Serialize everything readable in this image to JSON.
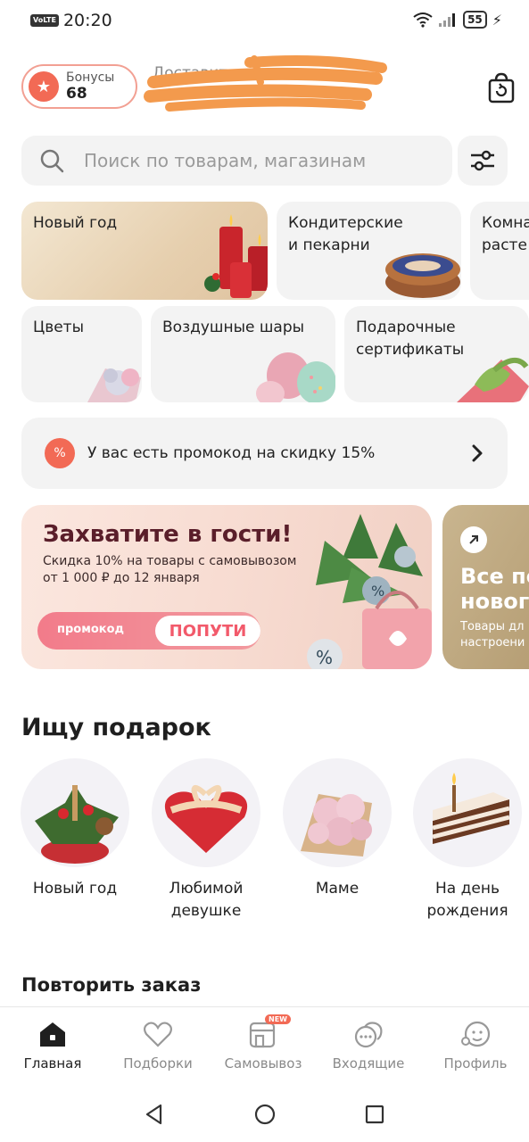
{
  "status_bar": {
    "volte": "VoLTE",
    "time": "20:20",
    "battery": "55"
  },
  "header": {
    "bonus_label": "Бонусы",
    "bonus_value": "68",
    "deliver_label": "Доставить:"
  },
  "search": {
    "placeholder": "Поиск по товарам, магазинам"
  },
  "categories": [
    {
      "label": "Новый год"
    },
    {
      "label": "Кондитерские\nи пекарни"
    },
    {
      "label": "Комна\nрасте"
    },
    {
      "label": "Цветы"
    },
    {
      "label": "Воздушные шары"
    },
    {
      "label": "Подарочные\nсертификаты"
    }
  ],
  "promo": {
    "icon_text": "%",
    "text": "У вас есть промокод на скидку 15%"
  },
  "banner": {
    "title": "Захватите в гости!",
    "subtitle": "Скидка 10% на товары с самовывозом\nот 1 000 ₽ до 12 января",
    "code_label": "промокод",
    "code_value": "ПОПУТИ"
  },
  "banner2": {
    "title": "Все пе\nновог",
    "subtitle": "Товары дл\nнастроени"
  },
  "gifts": {
    "title": "Ищу подарок",
    "items": [
      {
        "label": "Новый год"
      },
      {
        "label": "Любимой\nдевушке"
      },
      {
        "label": "Маме"
      },
      {
        "label": "На день\nрождения"
      }
    ]
  },
  "repeat": {
    "title": "Повторить заказ"
  },
  "nav": {
    "items": [
      {
        "label": "Главная",
        "icon": "home-icon"
      },
      {
        "label": "Подборки",
        "icon": "heart-icon"
      },
      {
        "label": "Самовывоз",
        "icon": "store-icon",
        "badge": "NEW"
      },
      {
        "label": "Входящие",
        "icon": "chat-icon"
      },
      {
        "label": "Профиль",
        "icon": "profile-icon"
      }
    ]
  },
  "colors": {
    "accent": "#f26a55",
    "surface": "#f3f3f3"
  }
}
